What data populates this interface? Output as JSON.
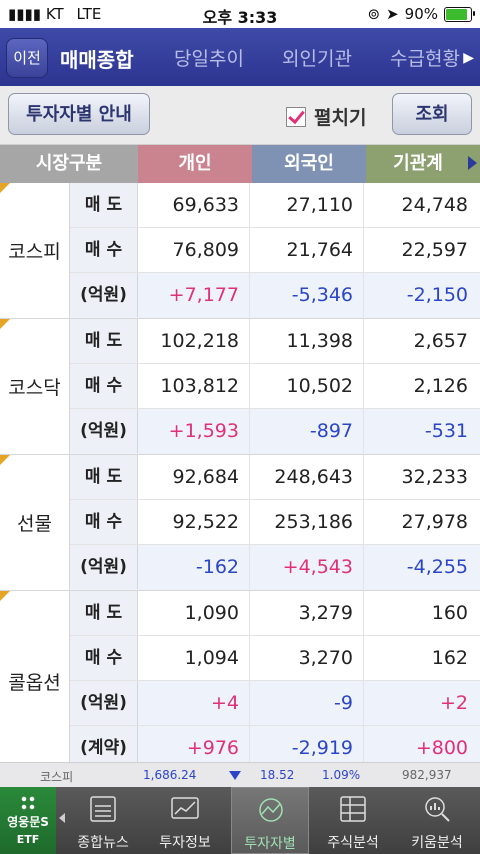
{
  "status": {
    "carrier": "KT",
    "network": "LTE",
    "time": "오후 3:33",
    "battery": "90%"
  },
  "header": {
    "back_label": "이전",
    "tabs": [
      {
        "label": "매매종합",
        "active": true
      },
      {
        "label": "당일추이",
        "active": false
      },
      {
        "label": "외인기관",
        "active": false
      },
      {
        "label": "수급현황",
        "active": false
      }
    ]
  },
  "toolbar": {
    "guide_label": "투자자별 안내",
    "expand_label": "펼치기",
    "expand_checked": true,
    "search_label": "조회"
  },
  "table": {
    "headers": [
      "시장구분",
      "개인",
      "외국인",
      "기관계"
    ],
    "groups": [
      {
        "market": "코스피",
        "rows": [
          {
            "label": "매 도",
            "values": [
              "69,633",
              "27,110",
              "24,748"
            ]
          },
          {
            "label": "매 수",
            "values": [
              "76,809",
              "21,764",
              "22,597"
            ]
          },
          {
            "label": "(억원)",
            "values": [
              "+7,177",
              "-5,346",
              "-2,150"
            ]
          }
        ]
      },
      {
        "market": "코스닥",
        "rows": [
          {
            "label": "매 도",
            "values": [
              "102,218",
              "11,398",
              "2,657"
            ]
          },
          {
            "label": "매 수",
            "values": [
              "103,812",
              "10,502",
              "2,126"
            ]
          },
          {
            "label": "(억원)",
            "values": [
              "+1,593",
              "-897",
              "-531"
            ]
          }
        ]
      },
      {
        "market": "선물",
        "rows": [
          {
            "label": "매 도",
            "values": [
              "92,684",
              "248,643",
              "32,233"
            ]
          },
          {
            "label": "매 수",
            "values": [
              "92,522",
              "253,186",
              "27,978"
            ]
          },
          {
            "label": "(억원)",
            "values": [
              "-162",
              "+4,543",
              "-4,255"
            ]
          }
        ]
      },
      {
        "market": "콜옵션",
        "rows": [
          {
            "label": "매 도",
            "values": [
              "1,090",
              "3,279",
              "160"
            ]
          },
          {
            "label": "매 수",
            "values": [
              "1,094",
              "3,270",
              "162"
            ]
          },
          {
            "label": "(억원)",
            "values": [
              "+4",
              "-9",
              "+2"
            ]
          },
          {
            "label": "(계약)",
            "values": [
              "+976",
              "-2,919",
              "+800"
            ]
          }
        ]
      }
    ]
  },
  "ticker": {
    "name": "코스피",
    "index": "1,686.24",
    "change": "18.52",
    "rate": "1.09%",
    "volume": "982,937"
  },
  "bottom_nav": {
    "logo_name": "영웅문S",
    "logo_sub": "ETF",
    "items": [
      {
        "label": "종합뉴스",
        "icon": "news-icon",
        "active": false
      },
      {
        "label": "투자정보",
        "icon": "chart-icon",
        "active": false
      },
      {
        "label": "투자자별",
        "icon": "investor-icon",
        "active": true
      },
      {
        "label": "주식분석",
        "icon": "table-icon",
        "active": false
      },
      {
        "label": "키움분석",
        "icon": "magnifier-chart-icon",
        "active": false
      }
    ]
  },
  "colors": {
    "header_bg": "#2c3590",
    "positive": "#e0307a",
    "negative": "#2b45c9"
  }
}
